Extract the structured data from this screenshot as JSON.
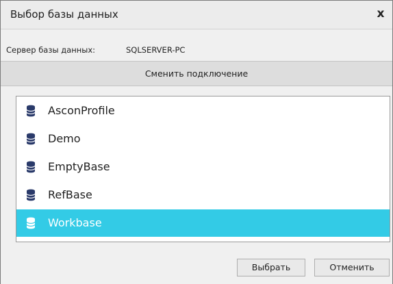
{
  "dialog": {
    "title": "Выбор базы данных",
    "close_label": "x"
  },
  "server": {
    "label": "Сервер базы данных:",
    "value": "SQLSERVER-PC"
  },
  "change_connection_label": "Сменить подключение",
  "databases": {
    "items": [
      {
        "label": "AsconProfile",
        "selected": false
      },
      {
        "label": "Demo",
        "selected": false
      },
      {
        "label": "EmptyBase",
        "selected": false
      },
      {
        "label": "RefBase",
        "selected": false
      },
      {
        "label": "Workbase",
        "selected": true
      }
    ],
    "icon": "database-icon"
  },
  "footer": {
    "select_label": "Выбрать",
    "cancel_label": "Отменить"
  },
  "colors": {
    "selection": "#33cbe6",
    "icon_normal": "#2a3a6a",
    "icon_selected": "#ffffff"
  }
}
